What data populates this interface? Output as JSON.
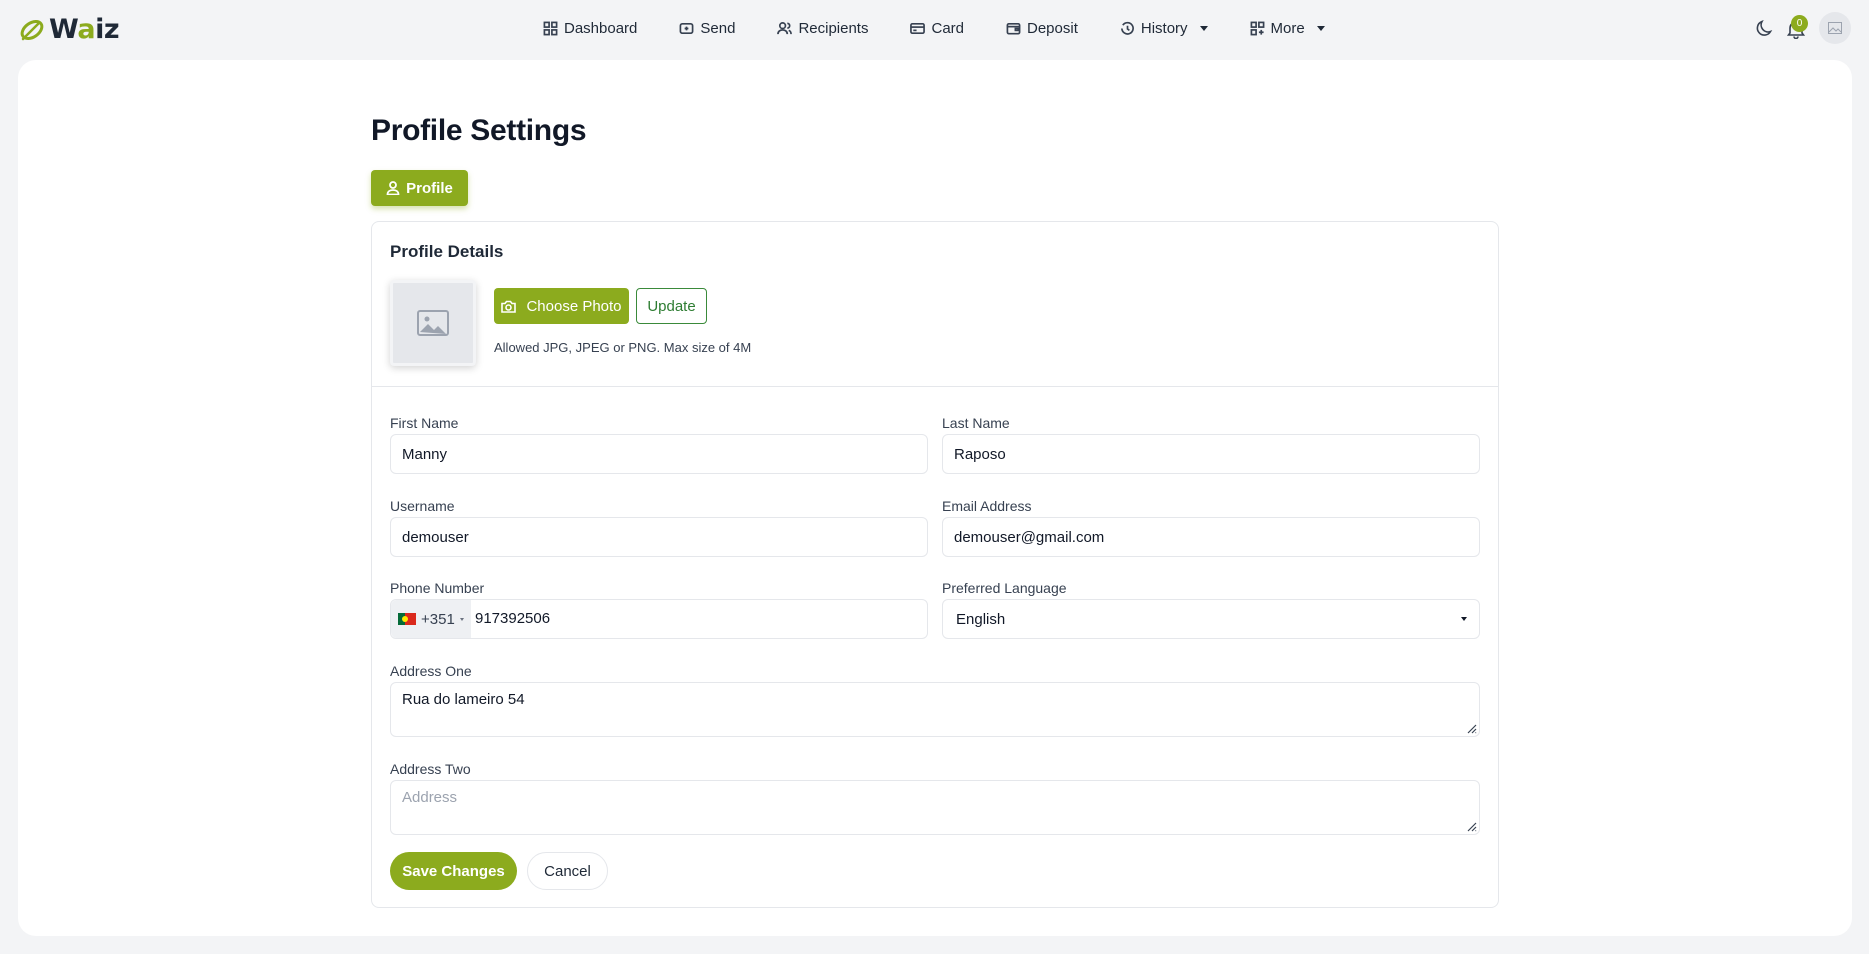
{
  "brand": {
    "name_prefix": "W",
    "name_accent": "a",
    "name_suffix": "iz",
    "accent_color": "#8cab1e"
  },
  "nav": {
    "items": [
      {
        "label": "Dashboard",
        "icon": "grid-icon"
      },
      {
        "label": "Send",
        "icon": "send-icon"
      },
      {
        "label": "Recipients",
        "icon": "users-icon"
      },
      {
        "label": "Card",
        "icon": "card-icon"
      },
      {
        "label": "Deposit",
        "icon": "wallet-icon"
      },
      {
        "label": "History",
        "icon": "history-icon",
        "dropdown": true
      },
      {
        "label": "More",
        "icon": "apps-icon",
        "dropdown": true
      }
    ]
  },
  "header": {
    "notification_count": "0"
  },
  "page": {
    "title": "Profile Settings",
    "tab_profile": "Profile"
  },
  "profile": {
    "section_title": "Profile Details",
    "choose_photo": "Choose Photo",
    "update": "Update",
    "photo_hint": "Allowed JPG, JPEG or PNG. Max size of 4M"
  },
  "form": {
    "first_name_label": "First Name",
    "first_name": "Manny",
    "last_name_label": "Last Name",
    "last_name": "Raposo",
    "username_label": "Username",
    "username": "demouser",
    "email_label": "Email Address",
    "email": "demouser@gmail.com",
    "phone_label": "Phone Number",
    "phone_code": "+351",
    "phone": "917392506",
    "language_label": "Preferred Language",
    "language": "English",
    "address_one_label": "Address One",
    "address_one": "Rua do lameiro 54",
    "address_two_label": "Address Two",
    "address_two_placeholder": "Address"
  },
  "actions": {
    "save": "Save Changes",
    "cancel": "Cancel"
  }
}
